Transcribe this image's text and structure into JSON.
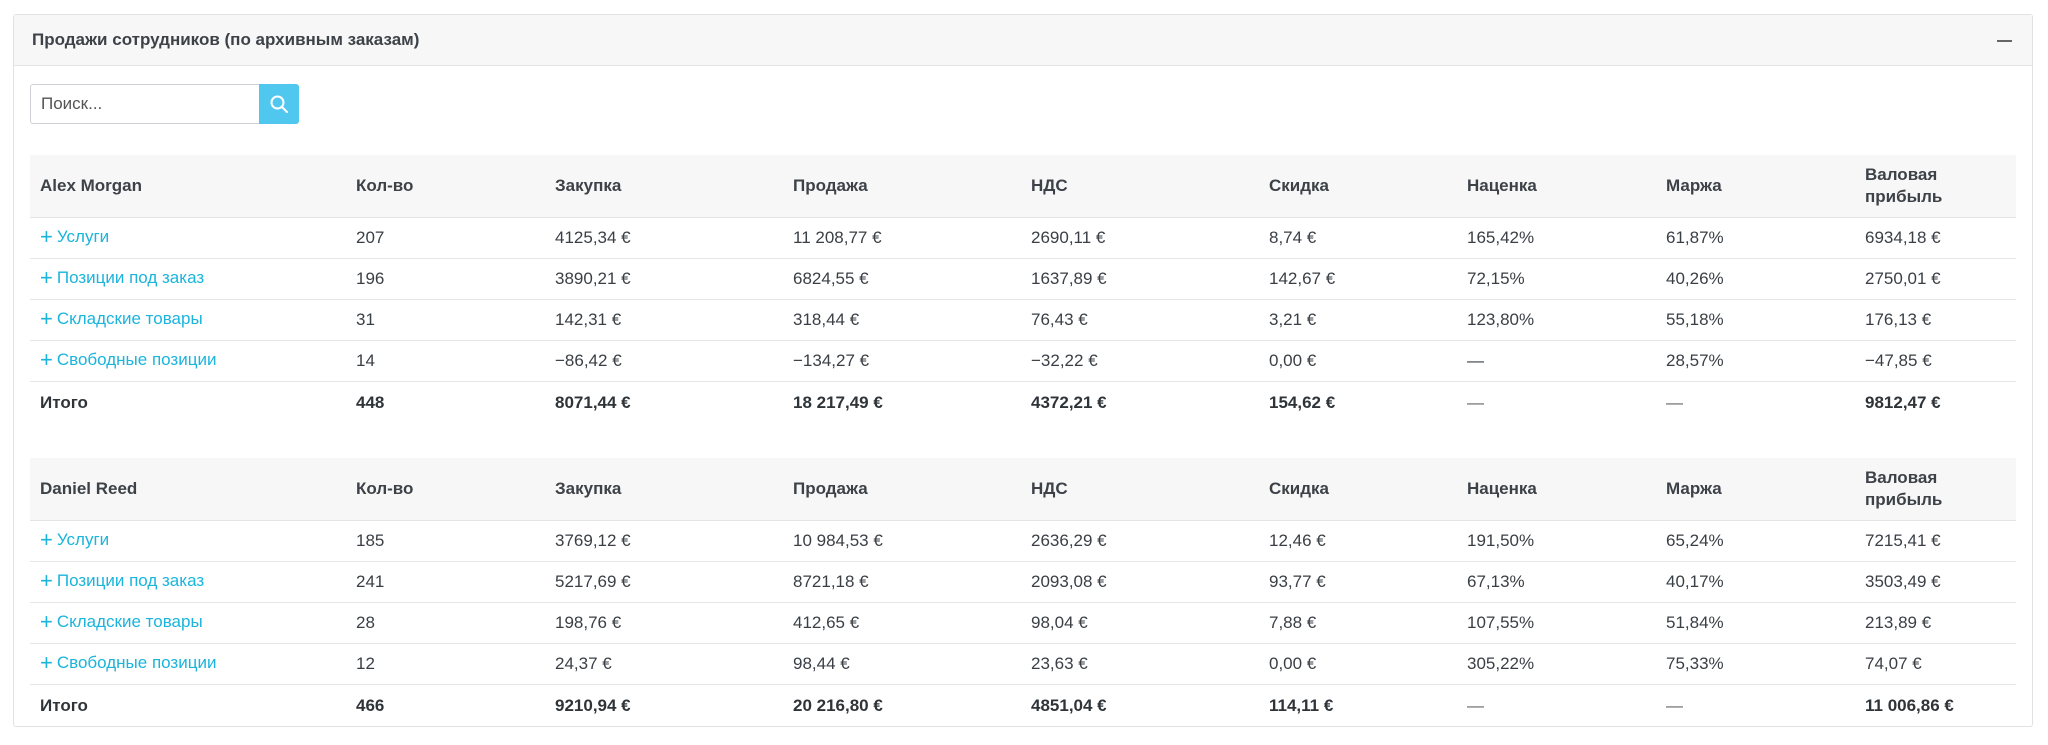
{
  "panel": {
    "title": "Продажи сотрудников (по архивным заказам)",
    "collapse_icon": "minus-icon"
  },
  "search": {
    "placeholder": "Поиск...",
    "icon": "search-icon",
    "accent_color": "#4fc7ef"
  },
  "columns": [
    "Кол-во",
    "Закупка",
    "Продажа",
    "НДС",
    "Скидка",
    "Наценка",
    "Маржа",
    "Валовая прибыль"
  ],
  "employees": [
    {
      "name": "Alex Morgan",
      "rows": [
        {
          "category": "Услуги",
          "qty": "207",
          "purchase": "4125,34 €",
          "sale": "11 208,77 €",
          "vat": "2690,11 €",
          "discount": "8,74 €",
          "markup": "165,42%",
          "margin": "61,87%",
          "gross": "6934,18 €"
        },
        {
          "category": "Позиции под заказ",
          "qty": "196",
          "purchase": "3890,21 €",
          "sale": "6824,55 €",
          "vat": "1637,89 €",
          "discount": "142,67 €",
          "markup": "72,15%",
          "margin": "40,26%",
          "gross": "2750,01 €"
        },
        {
          "category": "Складские товары",
          "qty": "31",
          "purchase": "142,31 €",
          "sale": "318,44 €",
          "vat": "76,43 €",
          "discount": "3,21 €",
          "markup": "123,80%",
          "margin": "55,18%",
          "gross": "176,13 €"
        },
        {
          "category": "Свободные позиции",
          "qty": "14",
          "purchase": "−86,42 €",
          "sale": "−134,27 €",
          "vat": "−32,22 €",
          "discount": "0,00 €",
          "markup": "—",
          "margin": "28,57%",
          "gross": "−47,85 €"
        }
      ],
      "total": {
        "label": "Итого",
        "qty": "448",
        "purchase": "8071,44 €",
        "sale": "18 217,49 €",
        "vat": "4372,21 €",
        "discount": "154,62 €",
        "markup": "—",
        "margin": "—",
        "gross": "9812,47 €"
      }
    },
    {
      "name": "Daniel Reed",
      "rows": [
        {
          "category": "Услуги",
          "qty": "185",
          "purchase": "3769,12 €",
          "sale": "10 984,53 €",
          "vat": "2636,29 €",
          "discount": "12,46 €",
          "markup": "191,50%",
          "margin": "65,24%",
          "gross": "7215,41 €"
        },
        {
          "category": "Позиции под заказ",
          "qty": "241",
          "purchase": "5217,69 €",
          "sale": "8721,18 €",
          "vat": "2093,08 €",
          "discount": "93,77 €",
          "markup": "67,13%",
          "margin": "40,17%",
          "gross": "3503,49 €"
        },
        {
          "category": "Складские товары",
          "qty": "28",
          "purchase": "198,76 €",
          "sale": "412,65 €",
          "vat": "98,04 €",
          "discount": "7,88 €",
          "markup": "107,55%",
          "margin": "51,84%",
          "gross": "213,89 €"
        },
        {
          "category": "Свободные позиции",
          "qty": "12",
          "purchase": "24,37 €",
          "sale": "98,44 €",
          "vat": "23,63 €",
          "discount": "0,00 €",
          "markup": "305,22%",
          "margin": "75,33%",
          "gross": "74,07 €"
        }
      ],
      "total": {
        "label": "Итого",
        "qty": "466",
        "purchase": "9210,94 €",
        "sale": "20 216,80 €",
        "vat": "4851,04 €",
        "discount": "114,11 €",
        "markup": "—",
        "margin": "—",
        "gross": "11 006,86 €"
      }
    }
  ]
}
